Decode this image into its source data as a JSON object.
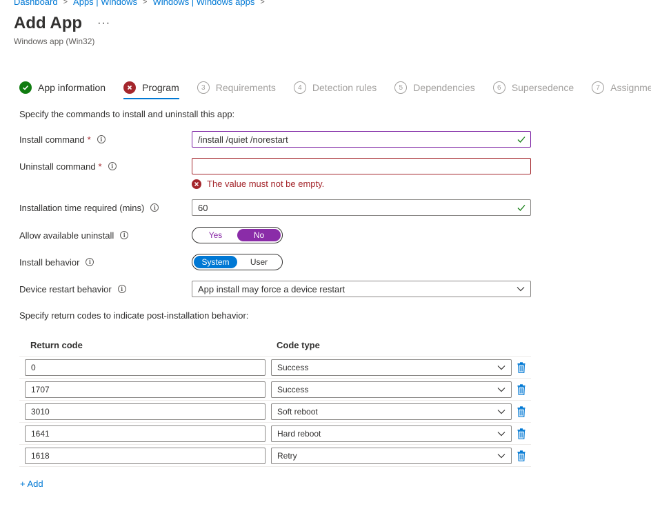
{
  "breadcrumb": {
    "items": [
      "Dashboard",
      "Apps | Windows",
      "Windows | Windows apps"
    ]
  },
  "header": {
    "title": "Add App",
    "more": "···",
    "subtitle": "Windows app (Win32)"
  },
  "tabs": [
    {
      "num": "1",
      "label": "App information",
      "state": "done"
    },
    {
      "num": "2",
      "label": "Program",
      "state": "error"
    },
    {
      "num": "3",
      "label": "Requirements",
      "state": "pending"
    },
    {
      "num": "4",
      "label": "Detection rules",
      "state": "pending"
    },
    {
      "num": "5",
      "label": "Dependencies",
      "state": "pending"
    },
    {
      "num": "6",
      "label": "Supersedence",
      "state": "pending"
    },
    {
      "num": "7",
      "label": "Assignments",
      "state": "pending"
    }
  ],
  "form": {
    "intro": "Specify the commands to install and uninstall this app:",
    "install_label": "Install command",
    "install_value": "/install /quiet /norestart",
    "uninstall_label": "Uninstall command",
    "uninstall_value": "",
    "uninstall_error": "The value must not be empty.",
    "time_label": "Installation time required (mins)",
    "time_value": "60",
    "allow_uninstall_label": "Allow available uninstall",
    "allow_uninstall_yes": "Yes",
    "allow_uninstall_no": "No",
    "behavior_label": "Install behavior",
    "behavior_system": "System",
    "behavior_user": "User",
    "restart_label": "Device restart behavior",
    "restart_value": "App install may force a device restart",
    "return_intro": "Specify return codes to indicate post-installation behavior:",
    "required_mark": "*"
  },
  "return_codes": {
    "header_code": "Return code",
    "header_type": "Code type",
    "rows": [
      {
        "code": "0",
        "type": "Success"
      },
      {
        "code": "1707",
        "type": "Success"
      },
      {
        "code": "3010",
        "type": "Soft reboot"
      },
      {
        "code": "1641",
        "type": "Hard reboot"
      },
      {
        "code": "1618",
        "type": "Retry"
      }
    ],
    "add_label": "+ Add"
  },
  "colors": {
    "accent": "#0078d4",
    "success": "#107c10",
    "error": "#a4262c",
    "toggle_purple": "#8a2ca8"
  }
}
